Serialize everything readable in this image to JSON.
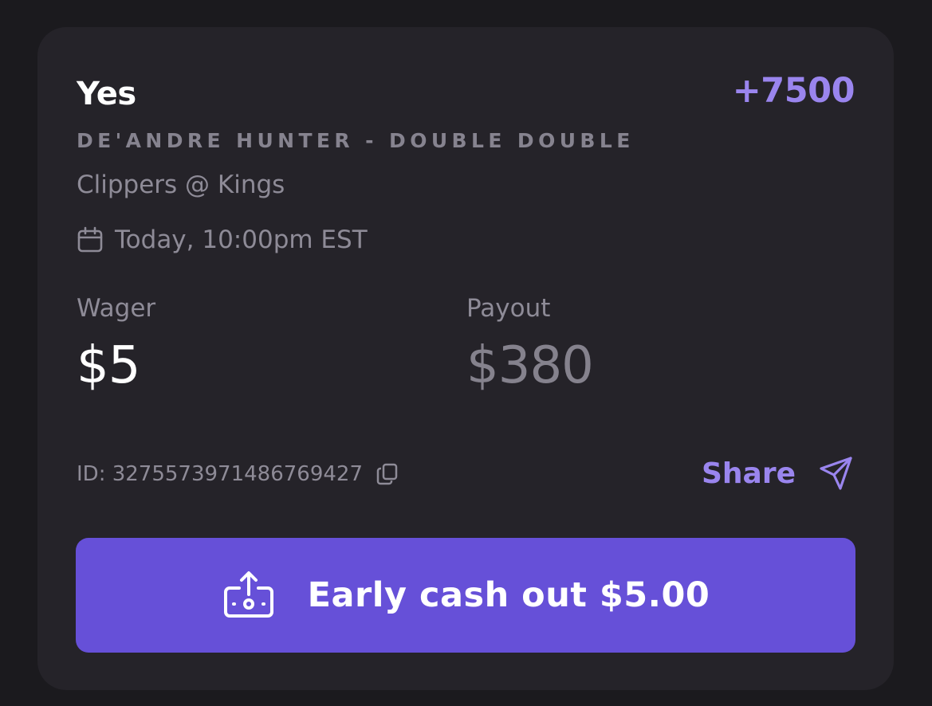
{
  "bet": {
    "pick": "Yes",
    "odds": "+7500",
    "market": "DE'ANDRE HUNTER - DOUBLE DOUBLE",
    "event": "Clippers @ Kings",
    "datetime": "Today, 10:00pm EST",
    "wager_label": "Wager",
    "wager_amount": "$5",
    "payout_label": "Payout",
    "payout_amount": "$380",
    "id_text": "ID: 3275573971486769427",
    "share_label": "Share",
    "cashout_label": "Early cash out $5.00"
  },
  "icons": {
    "date": "calendar-icon",
    "copy": "copy-icon",
    "share": "send-icon",
    "cashout": "cash-out-icon"
  },
  "colors": {
    "background": "#1b1a1e",
    "card": "#252329",
    "accent": "#9a85ee",
    "button": "#6650d8",
    "muted_text": "#8e8b97"
  }
}
